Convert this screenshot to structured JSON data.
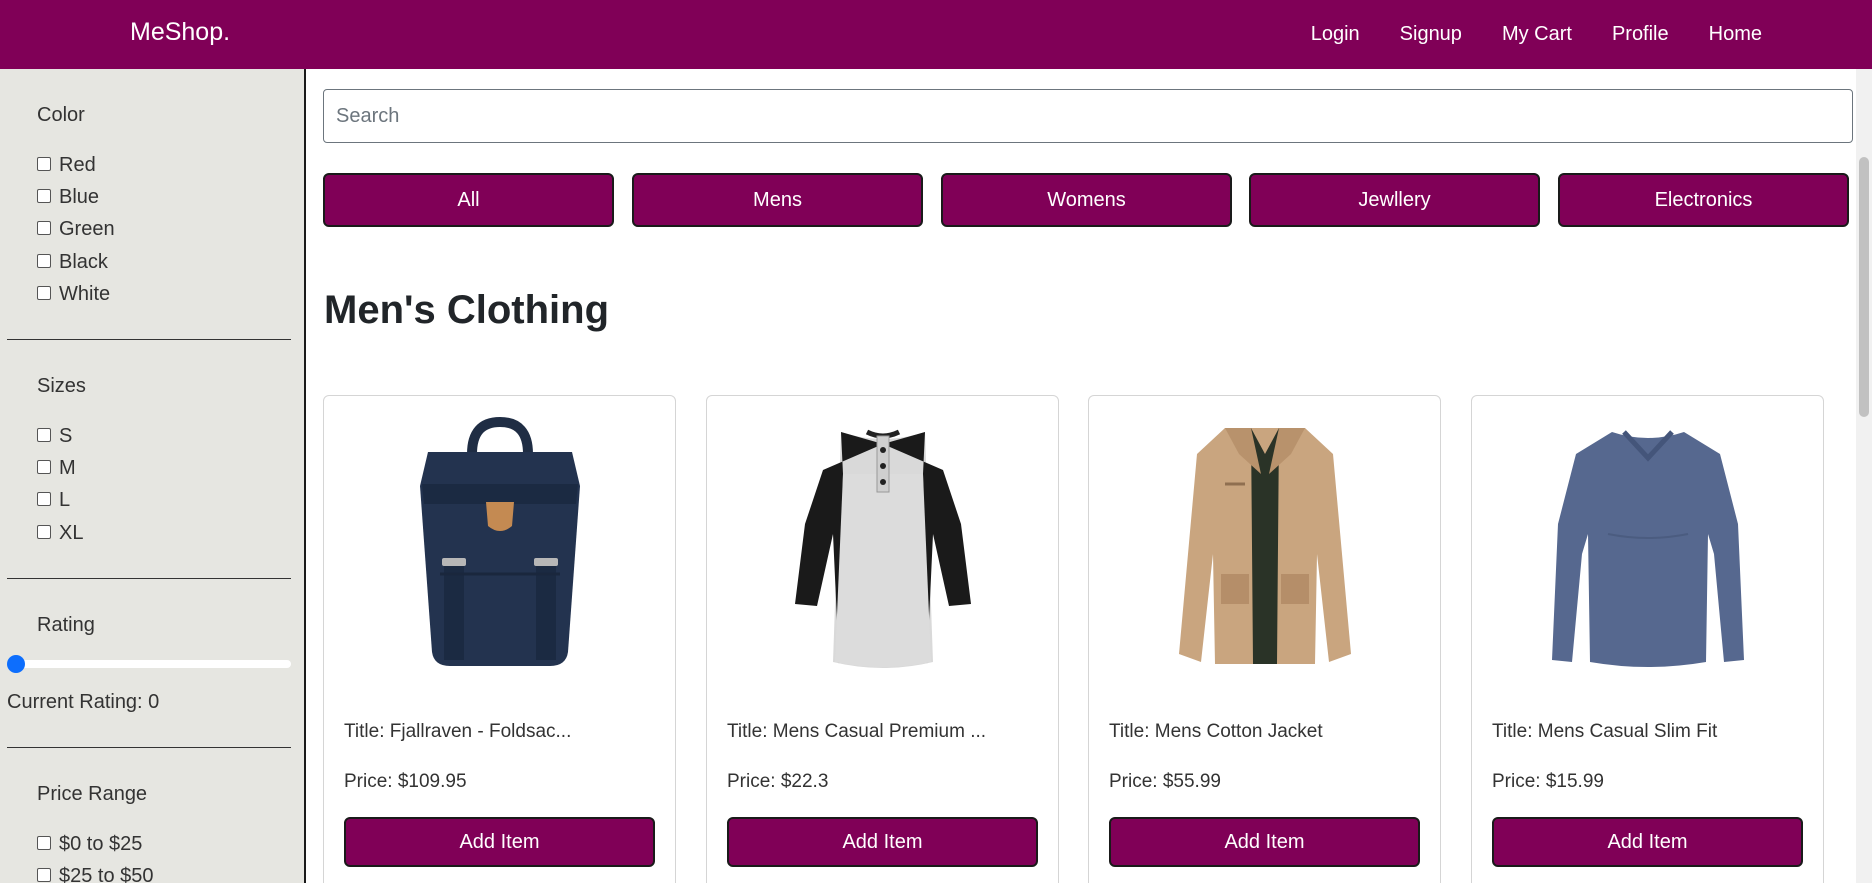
{
  "navbar": {
    "brand": "MeShop.",
    "links": [
      "Login",
      "Signup",
      "My Cart",
      "Profile",
      "Home"
    ],
    "bg_color": "#800057"
  },
  "sidebar": {
    "color": {
      "title": "Color",
      "options": [
        "Red",
        "Blue",
        "Green",
        "Black",
        "White"
      ]
    },
    "sizes": {
      "title": "Sizes",
      "options": [
        "S",
        "M",
        "L",
        "XL"
      ]
    },
    "rating": {
      "title": "Rating",
      "value": 0,
      "current_label": "Current Rating: 0"
    },
    "price": {
      "title": "Price Range",
      "options": [
        "$0 to $25",
        "$25 to $50"
      ]
    }
  },
  "search": {
    "placeholder": "Search"
  },
  "categories": [
    "All",
    "Mens",
    "Womens",
    "Jewllery",
    "Electronics"
  ],
  "section_title": "Men's Clothing",
  "products": [
    {
      "title": "Title: Fjallraven - Foldsac...",
      "price": "Price: $109.95",
      "button": "Add Item",
      "image": "backpack"
    },
    {
      "title": "Title: Mens Casual Premium ...",
      "price": "Price: $22.3",
      "button": "Add Item",
      "image": "raglan-shirt"
    },
    {
      "title": "Title: Mens Cotton Jacket",
      "price": "Price: $55.99",
      "button": "Add Item",
      "image": "jacket"
    },
    {
      "title": "Title: Mens Casual Slim Fit",
      "price": "Price: $15.99",
      "button": "Add Item",
      "image": "long-sleeve-shirt"
    }
  ],
  "colors": {
    "accent": "#800057",
    "sidebar_bg": "#e6e6e1",
    "slider": "#0d6efd"
  }
}
